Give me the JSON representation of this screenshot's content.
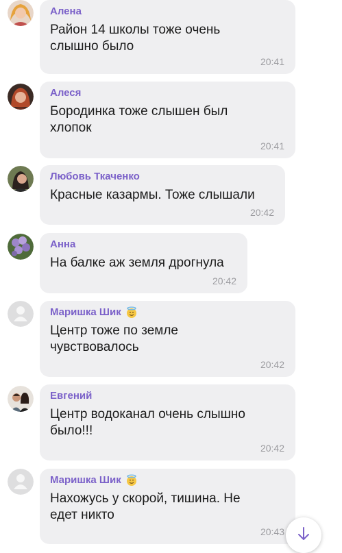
{
  "messages": [
    {
      "author": "Алена",
      "text": "Район 14 школы тоже очень\nслышно было",
      "time": "20:41",
      "avatar": "photo-woman-blonde"
    },
    {
      "author": "Алеся",
      "text": "Бородинка тоже слышен был\nхлопок",
      "time": "20:41",
      "avatar": "photo-woman-red"
    },
    {
      "author": "Любовь Ткаченко",
      "text": "Красные казармы. Тоже слышали",
      "time": "20:42",
      "avatar": "photo-woman-dark"
    },
    {
      "author": "Анна",
      "text": "На балке аж земля дрогнула",
      "time": "20:42",
      "avatar": "photo-flowers"
    },
    {
      "author": "Маришка Шик",
      "text": "Центр тоже  по земле\nчувствовалось",
      "time": "20:42",
      "avatar": "default-user-avatar",
      "emoji": "smiling-face-with-halo"
    },
    {
      "author": "Евгений",
      "text": "Центр водоканал очень слышно\nбыло!!!",
      "time": "20:42",
      "avatar": "photo-couple"
    },
    {
      "author": "Маришка Шик",
      "text": "Нахожусь у скорой, тишина. Не\nедет никто",
      "time": "20:43",
      "avatar": "default-user-avatar",
      "emoji": "smiling-face-with-halo"
    }
  ],
  "colors": {
    "author_name": "#7b61c9",
    "bubble": "#efeff1",
    "time": "#9c9ca0"
  },
  "scroll_button_icon": "arrow-down-icon"
}
